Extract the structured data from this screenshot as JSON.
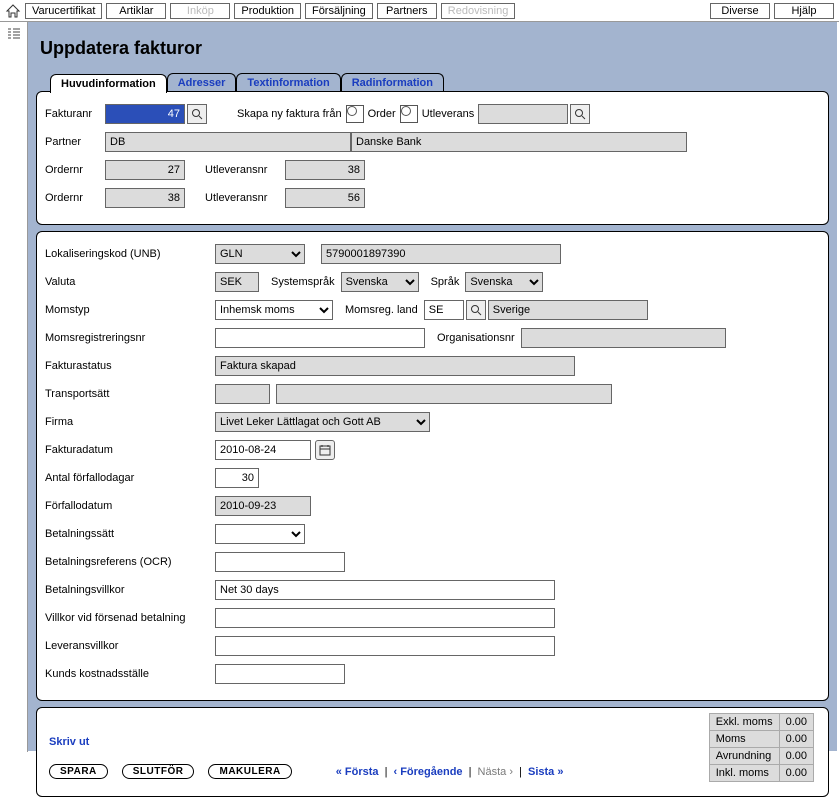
{
  "menu": {
    "varucertifikat": "Varucertifikat",
    "artiklar": "Artiklar",
    "inkop": "Inköp",
    "produktion": "Produktion",
    "forsaljning": "Försäljning",
    "partners": "Partners",
    "redovisning": "Redovisning",
    "diverse": "Diverse",
    "hjalp": "Hjälp"
  },
  "page_title": "Uppdatera fakturor",
  "tabs": {
    "huvudinformation": "Huvudinformation",
    "adresser": "Adresser",
    "textinformation": "Textinformation",
    "radinformation": "Radinformation"
  },
  "header": {
    "fakturanr_label": "Fakturanr",
    "fakturanr_value": "47",
    "skapa_label": "Skapa ny faktura från",
    "order_label": "Order",
    "utleverans_label": "Utleverans",
    "from_value": "",
    "partner_label": "Partner",
    "partner_code": "DB",
    "partner_name": "Danske Bank",
    "ordernr_label": "Ordernr",
    "utleveransnr_label": "Utleveransnr",
    "ordernr_1": "27",
    "utleveransnr_1": "38",
    "ordernr_2": "38",
    "utleveransnr_2": "56"
  },
  "main": {
    "lokaliseringskod_label": "Lokaliseringskod (UNB)",
    "lokalisering_type": "GLN",
    "lokalisering_value": "5790001897390",
    "valuta_label": "Valuta",
    "valuta_value": "SEK",
    "systemsprak_label": "Systemspråk",
    "systemsprak_value": "Svenska",
    "sprak_label": "Språk",
    "sprak_value": "Svenska",
    "momstyp_label": "Momstyp",
    "momstyp_value": "Inhemsk moms",
    "momsreg_land_label": "Momsreg. land",
    "momsreg_land_code": "SE",
    "momsreg_land_name": "Sverige",
    "momsregistreringsnr_label": "Momsregistreringsnr",
    "momsregistreringsnr_value": "",
    "organisationsnr_label": "Organisationsnr",
    "organisationsnr_value": "",
    "fakturastatus_label": "Fakturastatus",
    "fakturastatus_value": "Faktura skapad",
    "transportsatt_label": "Transportsätt",
    "transportsatt_code": "",
    "transportsatt_name": "",
    "firma_label": "Firma",
    "firma_value": "Livet Leker Lättlagat och Gott AB",
    "fakturadatum_label": "Fakturadatum",
    "fakturadatum_value": "2010-08-24",
    "antal_forfallo_label": "Antal förfallodagar",
    "antal_forfallo_value": "30",
    "forfallodatum_label": "Förfallodatum",
    "forfallodatum_value": "2010-09-23",
    "betalningssatt_label": "Betalningssätt",
    "betalningssatt_value": "",
    "betalningsreferens_label": "Betalningsreferens (OCR)",
    "betalningsreferens_value": "",
    "betalningsvillkor_label": "Betalningsvillkor",
    "betalningsvillkor_value": "Net 30 days",
    "villkor_forsenad_label": "Villkor vid försenad betalning",
    "villkor_forsenad_value": "",
    "leveransvillkor_label": "Leveransvillkor",
    "leveransvillkor_value": "",
    "kunds_kostnad_label": "Kunds kostnadsställe",
    "kunds_kostnad_value": ""
  },
  "footer": {
    "skriv_ut": "Skriv ut",
    "spara": "SPARA",
    "slutfor": "SLUTFÖR",
    "makulera": "MAKULERA",
    "forsta": "« Första",
    "foregaende": "‹ Föregående",
    "nasta": "Nästa ›",
    "sista": "Sista »",
    "exkl_moms_label": "Exkl. moms",
    "exkl_moms_value": "0.00",
    "moms_label": "Moms",
    "moms_value": "0.00",
    "avrundning_label": "Avrundning",
    "avrundning_value": "0.00",
    "inkl_moms_label": "Inkl. moms",
    "inkl_moms_value": "0.00"
  }
}
